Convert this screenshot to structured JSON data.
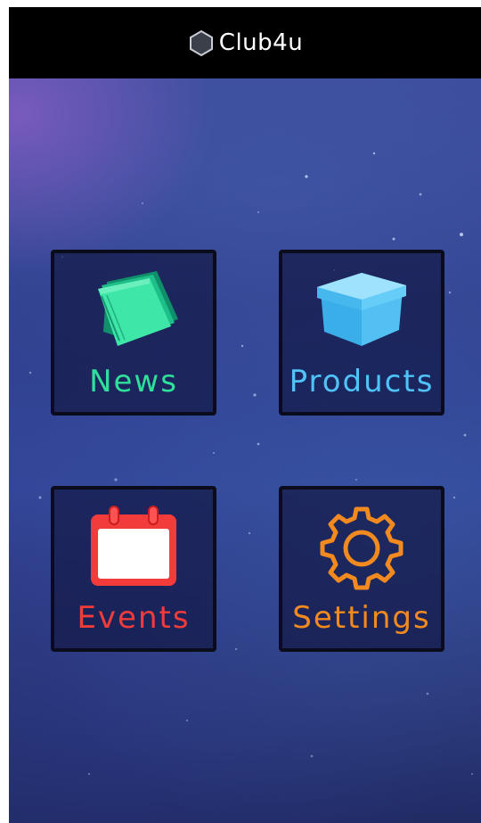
{
  "header": {
    "app_title": "Club4u",
    "logo_icon": "hexagon-icon"
  },
  "menu": {
    "tiles": [
      {
        "label": "News",
        "icon": "newspaper-icon",
        "color": "#2ee09a"
      },
      {
        "label": "Products",
        "icon": "box-icon",
        "color": "#4fc3f7"
      },
      {
        "label": "Events",
        "icon": "calendar-icon",
        "color": "#f23b3b"
      },
      {
        "label": "Settings",
        "icon": "gear-icon",
        "color": "#f28a1f"
      }
    ]
  },
  "colors": {
    "header_bg": "#000000",
    "background": "#2f3f8d",
    "tile_border": "#0a0c1c"
  }
}
